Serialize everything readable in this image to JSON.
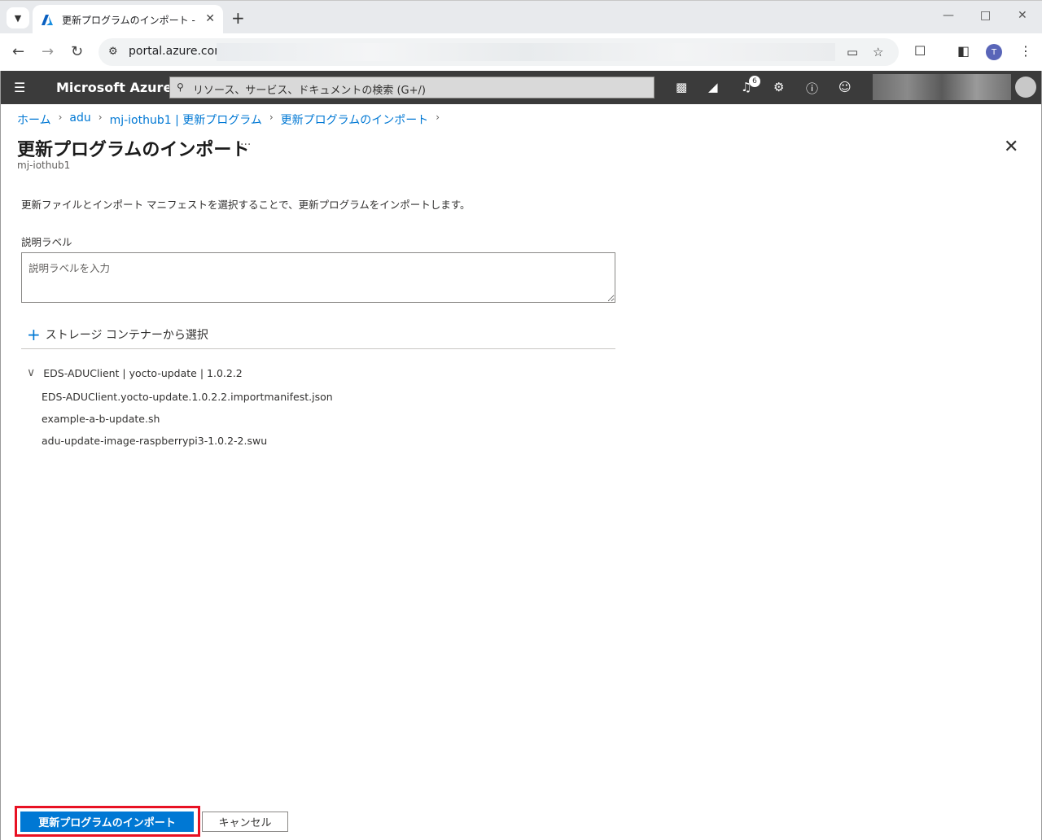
{
  "browser": {
    "tab_title": "更新プログラムのインポート - Micros",
    "url": "portal.azure.com",
    "profile_initial": "T"
  },
  "azure": {
    "brand": "Microsoft Azure",
    "search_placeholder": "リソース、サービス、ドキュメントの検索 (G+/)",
    "notification_count": "6"
  },
  "breadcrumb": {
    "items": [
      "ホーム",
      "adu",
      "mj-iothub1 | 更新プログラム",
      "更新プログラムのインポート"
    ]
  },
  "page": {
    "title": "更新プログラムのインポート",
    "more": "···",
    "subtitle": "mj-iothub1",
    "description": "更新ファイルとインポート マニフェストを選択することで、更新プログラムをインポートします。"
  },
  "form": {
    "label_field": "説明ラベル",
    "label_placeholder": "説明ラベルを入力",
    "storage_button": "ストレージ コンテナーから選択"
  },
  "tree": {
    "header": "EDS-ADUClient | yocto-update | 1.0.2.2",
    "files": [
      "EDS-ADUClient.yocto-update.1.0.2.2.importmanifest.json",
      "example-a-b-update.sh",
      "adu-update-image-raspberrypi3-1.0.2-2.swu"
    ]
  },
  "footer": {
    "primary_label": "更新プログラムのインポート",
    "cancel_label": "キャンセル"
  },
  "colors": {
    "accent": "#0078d4",
    "highlight": "#e81123",
    "topbar": "#3b3b3b"
  }
}
